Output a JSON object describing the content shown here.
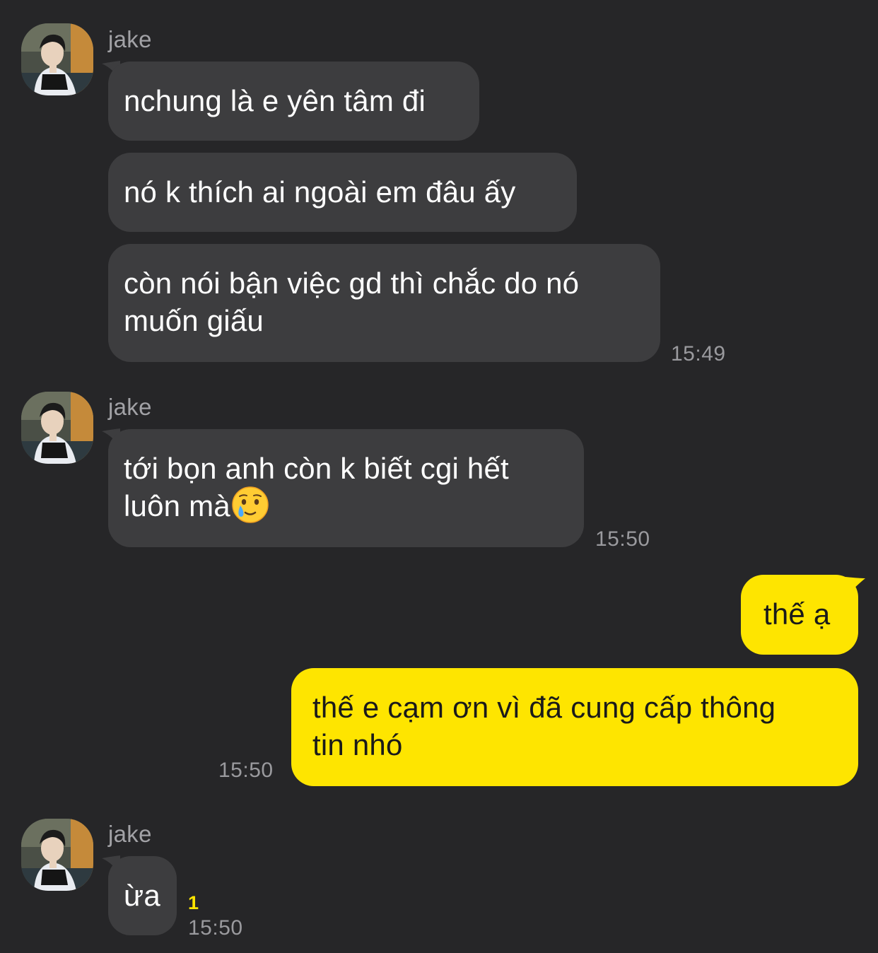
{
  "conversation": {
    "groups": [
      {
        "sender": "jake",
        "messages": [
          "nchung là e yên tâm đi",
          "nó k thích ai ngoài em đâu ấy",
          [
            "còn nói bận việc gd thì chắc do nó",
            "muốn giấu"
          ]
        ],
        "time": "15:49"
      },
      {
        "sender": "jake",
        "messages": [
          [
            "tới bọn anh còn k biết cgi hết",
            "luôn mà"
          ]
        ],
        "emoji": "crying-smile-emoji",
        "time": "15:50"
      },
      {
        "sender": "me",
        "messages": [
          "thế ạ",
          [
            "thế e cạm ơn vì đã cung cấp thông",
            "tin nhó"
          ]
        ],
        "time": "15:50"
      },
      {
        "sender": "jake",
        "messages": [
          "ừa"
        ],
        "unread_count": "1",
        "time": "15:50"
      }
    ]
  },
  "colors": {
    "background": "#262628",
    "incoming_bubble": "#3d3d3f",
    "outgoing_bubble": "#fee500",
    "timestamp": "#9a9a9e",
    "unread_badge": "#fee500"
  },
  "icons": {
    "avatar": "avatar-photo",
    "emoji": "crying-smile-emoji"
  }
}
